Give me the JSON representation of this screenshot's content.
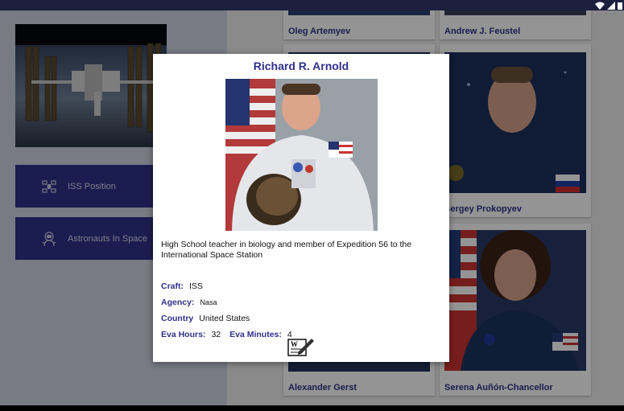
{
  "menu": {
    "iss_position": "ISS Position",
    "astronauts_in_space": "Astronauts In Space"
  },
  "astronauts": [
    {
      "name": "Oleg Artemyev"
    },
    {
      "name": "Andrew J. Feustel"
    },
    {
      "name": "Sergey Prokopyev"
    },
    {
      "name": "Alexander Gerst"
    },
    {
      "name": "Serena Auñón-Chancellor"
    }
  ],
  "dialog": {
    "name": "Richard R. Arnold",
    "description": "High School teacher in biology and member of Expedition 56 to the International Space Station",
    "craft_label": "Craft:",
    "craft": "ISS",
    "agency_label": "Agency:",
    "agency": "Nasa",
    "country_label": "Country",
    "country": "United States",
    "eva_hours_label": "Eva Hours:",
    "eva_hours": "32",
    "eva_minutes_label": "Eva Minutes:",
    "eva_minutes": "4",
    "edit_icon_text": "W"
  },
  "colors": {
    "accent": "#303189",
    "statusbar": "#1c1f3e",
    "left_panel": "#cfd2e4"
  },
  "icons": {
    "wifi": "wifi-icon",
    "signal": "signal-icon",
    "iss": "satellite-icon",
    "astronaut": "astronaut-icon",
    "edit": "edit-document-icon"
  }
}
